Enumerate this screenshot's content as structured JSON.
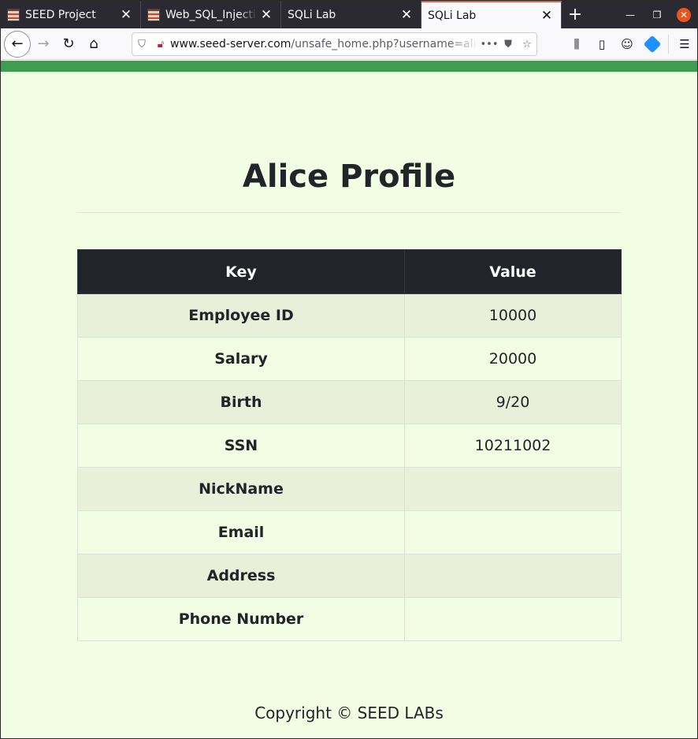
{
  "browser": {
    "tabs": [
      {
        "title": "SEED Project",
        "has_favicon": true,
        "active": false
      },
      {
        "title": "Web_SQL_Injection",
        "has_favicon": true,
        "active": false
      },
      {
        "title": "SQLi Lab",
        "has_favicon": false,
        "active": false
      },
      {
        "title": "SQLi Lab",
        "has_favicon": false,
        "active": true
      }
    ],
    "new_tab_label": "+",
    "url_host": "www.seed-server.com",
    "url_path": "/unsafe_home.php?username=alice&Password=",
    "accent_color": "#e0624f"
  },
  "page": {
    "title": "Alice Profile",
    "table_headers": {
      "key": "Key",
      "value": "Value"
    },
    "rows": [
      {
        "key": "Employee ID",
        "value": "10000"
      },
      {
        "key": "Salary",
        "value": "20000"
      },
      {
        "key": "Birth",
        "value": "9/20"
      },
      {
        "key": "SSN",
        "value": "10211002"
      },
      {
        "key": "NickName",
        "value": ""
      },
      {
        "key": "Email",
        "value": ""
      },
      {
        "key": "Address",
        "value": ""
      },
      {
        "key": "Phone Number",
        "value": ""
      }
    ],
    "footer": "Copyright © SEED LABs",
    "header_strip_color": "#3e9d4f",
    "background_color": "#f2fee3"
  }
}
